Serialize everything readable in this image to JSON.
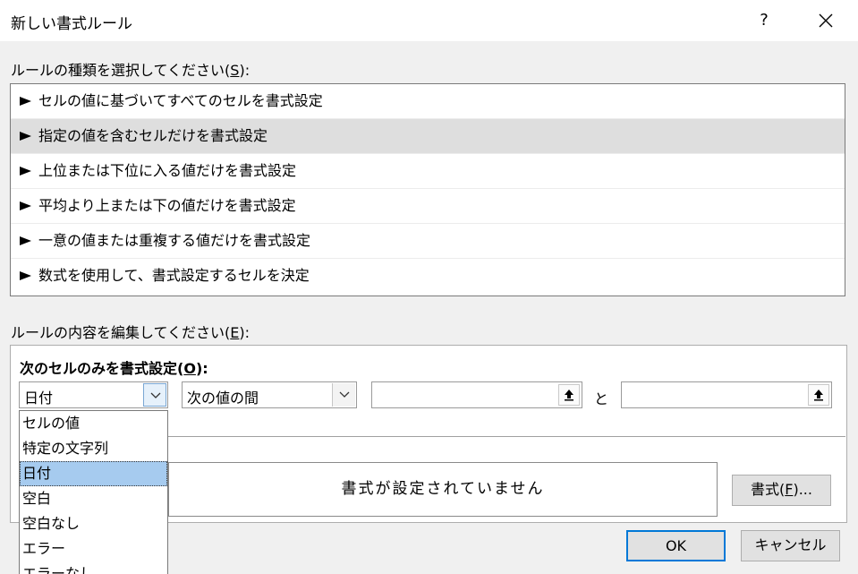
{
  "dialog": {
    "title": "新しい書式ルール",
    "help_label": "?"
  },
  "rule_type": {
    "label_pre": "ルールの種類を選択してください(",
    "label_key": "S",
    "label_post": "):",
    "items": [
      {
        "label": "セルの値に基づいてすべてのセルを書式設定"
      },
      {
        "label": "指定の値を含むセルだけを書式設定"
      },
      {
        "label": "上位または下位に入る値だけを書式設定"
      },
      {
        "label": "平均より上または下の値だけを書式設定"
      },
      {
        "label": "一意の値または重複する値だけを書式設定"
      },
      {
        "label": "数式を使用して、書式設定するセルを決定"
      }
    ],
    "selected_index": 1
  },
  "rule_edit": {
    "label_pre": "ルールの内容を編集してください(",
    "label_key": "E",
    "label_post": "):",
    "condition_pre": "次のセルのみを書式設定(",
    "condition_key": "O",
    "condition_post": "):",
    "type_combo": {
      "value": "日付"
    },
    "operator_combo": {
      "value": "次の値の間"
    },
    "value1": "",
    "and_label": "と",
    "value2": "",
    "dropdown_options": [
      "セルの値",
      "特定の文字列",
      "日付",
      "空白",
      "空白なし",
      "エラー",
      "エラーなし"
    ],
    "dropdown_selected_index": 2
  },
  "preview": {
    "text": "書式が設定されていません",
    "format_button_pre": "書式(",
    "format_button_key": "F",
    "format_button_post": ")..."
  },
  "buttons": {
    "ok": "OK",
    "cancel": "キャンセル"
  },
  "colors": {
    "dialog_bg": "#f0f0f0",
    "selected_rule_bg": "#dedede",
    "dropdown_highlight": "#a6cbef",
    "default_button_border": "#0078d7"
  }
}
